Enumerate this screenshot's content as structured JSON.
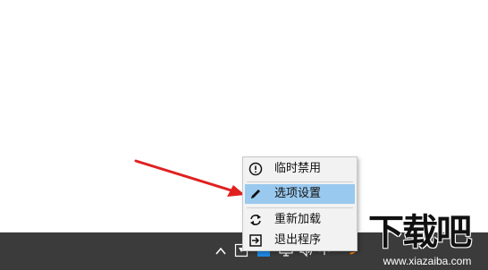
{
  "context_menu": {
    "items": [
      {
        "label": "临时禁用",
        "icon": "exclamation-circle-icon"
      },
      {
        "label": "选项设置",
        "icon": "pencil-icon",
        "highlighted": true
      },
      {
        "label": "重新加载",
        "icon": "reload-icon"
      },
      {
        "label": "退出程序",
        "icon": "exit-icon"
      }
    ],
    "highlight_color": "#99c9ef"
  },
  "annotation": {
    "arrow_color": "#e02020"
  },
  "taskbar": {
    "background": "#3b3b3b",
    "tray_icons": [
      "show-hidden-chevron-icon",
      "app-tray-icon",
      "blue-app-tray-icon",
      "network-icon",
      "volume-icon",
      "input-method-icon",
      "orange-app-icon"
    ],
    "ime_label": "中"
  },
  "watermark": {
    "logo_text": "下载吧",
    "url": "www.xiazaiba.com"
  }
}
